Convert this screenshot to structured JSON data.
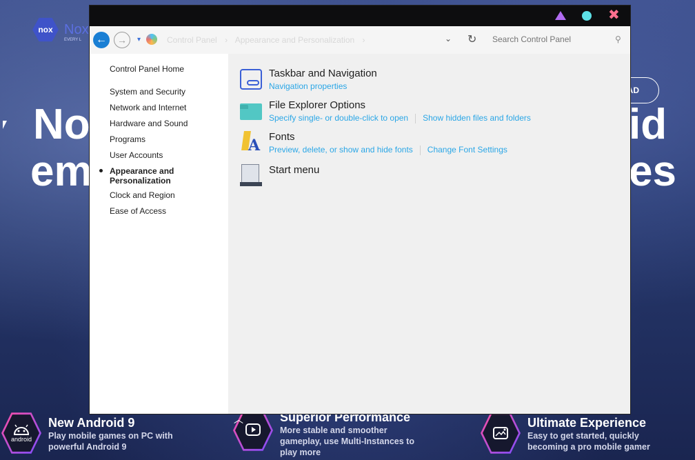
{
  "background": {
    "logo_text": "Nox",
    "logo_tagline": "EVERY L",
    "header_button_partial": "AD",
    "headline_left_1": "No",
    "headline_left_2": "em",
    "headline_right_1": "id",
    "headline_right_2": "es",
    "features": [
      {
        "title": "New Android 9",
        "desc": "Play mobile games on PC with powerful Android 9",
        "icon": "android-icon",
        "icon_label": "android"
      },
      {
        "title": "Superior Performance",
        "desc": "More stable and smoother gameplay, use Multi-Instances to play more",
        "icon": "play-icon"
      },
      {
        "title": "Ultimate Experience",
        "desc": "Easy to get started, quickly becoming a pro mobile gamer",
        "icon": "photo-sparkle-icon"
      }
    ]
  },
  "window": {
    "controls": {
      "minimize_icon": "triangle-icon",
      "maximize_icon": "circle-icon",
      "close_icon": "close-icon",
      "close_glyph": "✖"
    },
    "address": {
      "breadcrumbs": [
        "Control Panel",
        "Appearance and Personalization"
      ],
      "separator": "›",
      "search_placeholder": "Search Control Panel"
    },
    "sidebar": {
      "home": "Control Panel Home",
      "items": [
        {
          "label": "System and Security",
          "active": false
        },
        {
          "label": "Network and Internet",
          "active": false
        },
        {
          "label": "Hardware and Sound",
          "active": false
        },
        {
          "label": "Programs",
          "active": false
        },
        {
          "label": "User Accounts",
          "active": false
        },
        {
          "label": "Appearance and Personalization",
          "active": true
        },
        {
          "label": "Clock and Region",
          "active": false
        },
        {
          "label": "Ease of Access",
          "active": false
        }
      ]
    },
    "categories": [
      {
        "title": "Taskbar and Navigation",
        "icon": "taskbar-icon",
        "links": [
          "Navigation properties"
        ]
      },
      {
        "title": "File Explorer Options",
        "icon": "folder-icon",
        "links": [
          "Specify single- or double-click to open",
          "Show hidden files and folders"
        ]
      },
      {
        "title": "Fonts",
        "icon": "fonts-icon",
        "links": [
          "Preview, delete, or show and hide fonts",
          "Change Font Settings"
        ]
      },
      {
        "title": "Start menu",
        "icon": "start-menu-icon",
        "links": []
      }
    ]
  },
  "colors": {
    "accent_blue": "#1a7fd4",
    "link_blue": "#2aa6e6",
    "titlebar": "#0d0d0f",
    "nox_purple": "#3f53c9"
  }
}
